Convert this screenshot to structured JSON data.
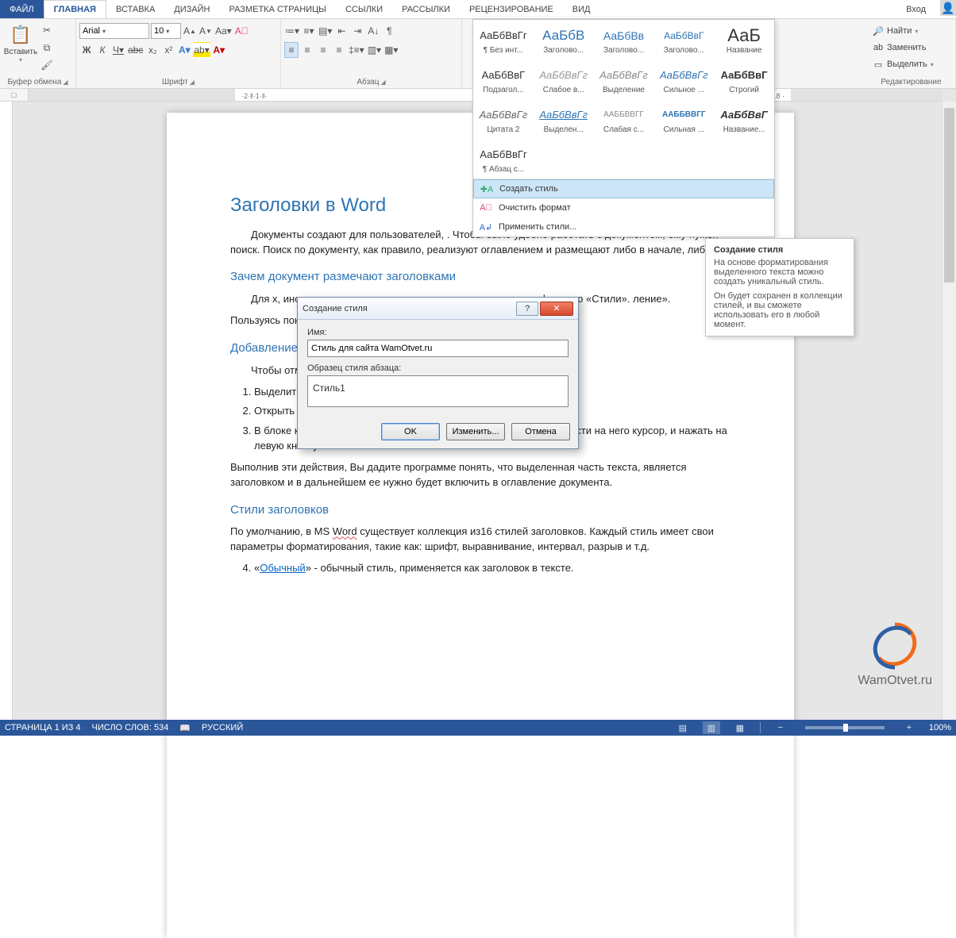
{
  "tabs": {
    "file": "ФАЙЛ",
    "home": "ГЛАВНАЯ",
    "insert": "ВСТАВКА",
    "design": "ДИЗАЙН",
    "layout": "РАЗМЕТКА СТРАНИЦЫ",
    "refs": "ССЫЛКИ",
    "mail": "РАССЫЛКИ",
    "review": "РЕЦЕНЗИРОВАНИЕ",
    "view": "ВИД",
    "login": "Вход"
  },
  "ribbon": {
    "clipboard": {
      "label": "Буфер обмена",
      "paste": "Вставить"
    },
    "font": {
      "label": "Шрифт",
      "name": "Arial",
      "size": "10"
    },
    "para": {
      "label": "Абзац"
    },
    "editing": {
      "label": "Редактирование",
      "find": "Найти",
      "replace": "Заменить",
      "select": "Выделить"
    }
  },
  "styles": {
    "rows": [
      [
        {
          "prev": "АаБбВвГг",
          "name": "¶ Без инт..."
        },
        {
          "prev": "АаБбВ",
          "name": "Заголово...",
          "cls": "h1"
        },
        {
          "prev": "АаБбВв",
          "name": "Заголово...",
          "cls": "h2"
        },
        {
          "prev": "АаБбВвГ",
          "name": "Заголово...",
          "cls": "h3"
        },
        {
          "prev": "АаБ",
          "name": "Название",
          "cls": "title"
        }
      ],
      [
        {
          "prev": "АаБбВвГ",
          "name": "Подзагол..."
        },
        {
          "prev": "АаБбВвГг",
          "name": "Слабое в...",
          "cls": "subtle"
        },
        {
          "prev": "АаБбВвГг",
          "name": "Выделение",
          "cls": "emph"
        },
        {
          "prev": "АаБбВвГг",
          "name": "Сильное ...",
          "cls": "intense"
        },
        {
          "prev": "АаБбВвГ",
          "name": "Строгий",
          "cls": "strong"
        }
      ],
      [
        {
          "prev": "АаБбВвГг",
          "name": "Цитата 2",
          "cls": "quote"
        },
        {
          "prev": "АаБбВвГг",
          "name": "Выделен...",
          "cls": "iq"
        },
        {
          "prev": "АаБбВвГг",
          "name": "Слабая с...",
          "cls": "sref"
        },
        {
          "prev": "АаБбВвГг",
          "name": "Сильная ...",
          "cls": "iref"
        },
        {
          "prev": "АаБбВвГ",
          "name": "Название...",
          "cls": "book"
        }
      ],
      [
        {
          "prev": "АаБбВвГг",
          "name": "¶ Абзац с..."
        }
      ]
    ],
    "menu": {
      "create": "Создать стиль",
      "clear": "Очистить формат",
      "apply": "Применить стили..."
    }
  },
  "tooltip": {
    "title": "Создание стиля",
    "p1": "На основе форматирования выделенного текста можно создать уникальный стиль.",
    "p2": "Он будет сохранен в коллекции стилей, и вы сможете использовать его в любой момент."
  },
  "doc": {
    "h1": "Заголовки в Word",
    "p1": "Документы создают для пользователей,                                                        . Чтобы было удобно работать с документом, ему нужен поиск. Поиск по документу, как правило, реализуют оглавлением и размещают либо в начале, либо                              .",
    "h2a": "Зачем документ размечают заголовками",
    "p2": "Для                                                           х, инструкциях используют оглавление                                                                ния используют функцию «Стили».                                                                ление».",
    "p3": "Пользуясь                                                                    понадобится вручную редактиро                                                                раниц. Об этом позаботит",
    "h2b": "Добавление заголовка",
    "p4": "Чтобы отметить заголовок необходимо:",
    "li1": "Выделить заголовок.",
    "li2": "Открыть вкладку основного меню «Главная».",
    "li3": "В блоке команд «Стили» выбрать понравившийся Вам стиль, навести на него курсор, и нажать на левую кнопку мыши.",
    "p5": "Выполнив эти действия, Вы дадите программе понять, что выделенная часть текста, является заголовком и в дальнейшем ее нужно будет включить в оглавление документа.",
    "h2c": "Стили заголовков",
    "p6a": "По умолчанию, в MS ",
    "p6w": "Word",
    "p6b": " существует коллекция из16 стилей заголовков. Каждый стиль имеет свои параметры форматирования, такие как: шрифт, выравнивание, интервал, разрыв и т.д.",
    "li4a": "«",
    "li4u": "Обычный",
    "li4b": "» - обычный стиль, применяется как заголовок в тексте."
  },
  "dialog": {
    "title": "Создание стиля",
    "nameLbl": "Имя:",
    "nameVal": "Стиль для сайта WamOtvet.ru",
    "sampleLbl": "Образец стиля абзаца:",
    "sampleVal": "Стиль1",
    "ok": "OK",
    "modify": "Изменить...",
    "cancel": "Отмена"
  },
  "status": {
    "page": "СТРАНИЦА 1 ИЗ 4",
    "words": "ЧИСЛО СЛОВ: 534",
    "lang": "РУССКИЙ",
    "zoom": "100%"
  },
  "watermark": "WamOtvet.ru"
}
